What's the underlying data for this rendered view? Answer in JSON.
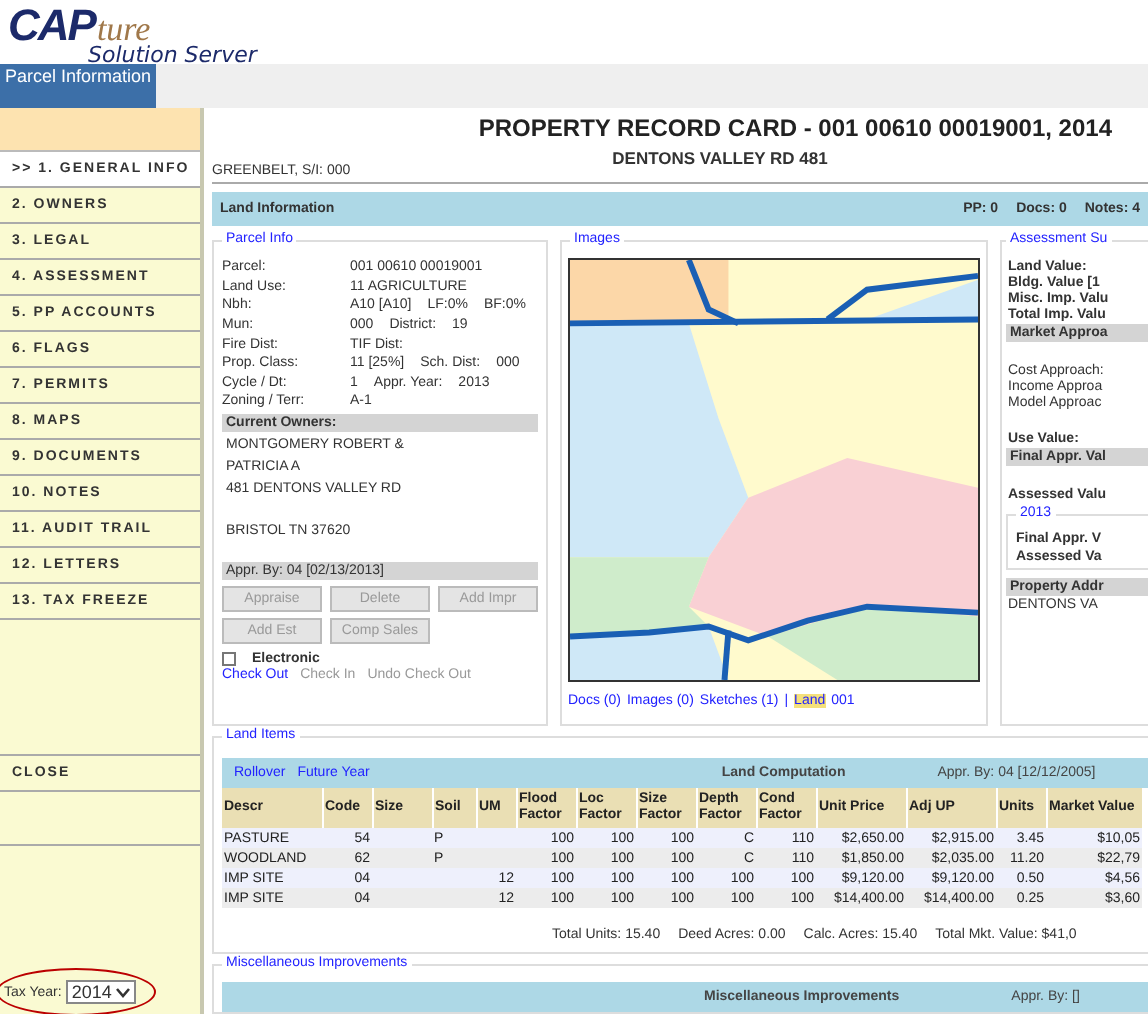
{
  "logo": {
    "main": "CAP",
    "script": "ture",
    "subtitle": "Solution Server"
  },
  "tabs": [
    {
      "label": "Parcel Information",
      "selected": true
    }
  ],
  "sidebar": {
    "items": [
      {
        "label": ">> 1. GENERAL INFO",
        "selected": true
      },
      {
        "label": "2. OWNERS",
        "selected": false
      },
      {
        "label": "3. LEGAL",
        "selected": false
      },
      {
        "label": "4. ASSESSMENT",
        "selected": false
      },
      {
        "label": "5. PP ACCOUNTS",
        "selected": false
      },
      {
        "label": "6. FLAGS",
        "selected": false
      },
      {
        "label": "7. PERMITS",
        "selected": false
      },
      {
        "label": "8. MAPS",
        "selected": false
      },
      {
        "label": "9. DOCUMENTS",
        "selected": false
      },
      {
        "label": "10. NOTES",
        "selected": false
      },
      {
        "label": "11. AUDIT TRAIL",
        "selected": false
      },
      {
        "label": "12. LETTERS",
        "selected": false
      },
      {
        "label": "13. TAX FREEZE",
        "selected": false
      }
    ],
    "close": "CLOSE",
    "tax_year": {
      "label": "Tax Year:",
      "value": "2014",
      "highlighted": true
    }
  },
  "header": {
    "title": "PROPERTY RECORD CARD - 001 00610 00019001, 2014",
    "address": "DENTONS VALLEY RD 481",
    "district": "GREENBELT, S/I: 000"
  },
  "land_information": {
    "title": "Land Information",
    "counts": [
      "PP: 0",
      "Docs: 0",
      "Notes: 4"
    ]
  },
  "parcel_info": {
    "legend": "Parcel Info",
    "rows": [
      [
        "Parcel:",
        "001 00610 00019001"
      ],
      [
        "Land Use:",
        "11 AGRICULTURE"
      ],
      [
        "Nbh:",
        "A10  [A10]",
        "LF:0%",
        "BF:0%"
      ],
      [
        "Mun:",
        "000",
        "District:",
        "19"
      ],
      [
        "Fire Dist:",
        "TIF Dist:"
      ],
      [
        "Prop. Class:",
        "11  [25%]",
        "Sch. Dist:",
        "000"
      ],
      [
        "Cycle / Dt:",
        "1",
        "Appr. Year:",
        "2013"
      ],
      [
        "Zoning / Terr:",
        "A-1"
      ]
    ],
    "owners_header": "Current Owners:",
    "owner_lines": [
      {
        "text": "MONTGOMERY ROBERT &",
        "gap_before": false
      },
      {
        "text": "PATRICIA A",
        "gap_before": false
      },
      {
        "text": "481 DENTONS VALLEY RD",
        "gap_before": false
      },
      {
        "text": "BRISTOL TN 37620",
        "gap_before": true
      }
    ],
    "appraised_by": "Appr. By: 04 [02/13/2013]",
    "buttons": [
      {
        "label": "Appraise",
        "disabled": true
      },
      {
        "label": "Delete",
        "disabled": true
      },
      {
        "label": "Add Impr",
        "disabled": true
      },
      {
        "label": "Add Est",
        "disabled": true
      },
      {
        "label": "Comp Sales",
        "disabled": true
      }
    ],
    "electronic": {
      "label": "Electronic",
      "checked": false
    },
    "links": [
      {
        "label": "Check Out",
        "disabled": false
      },
      {
        "label": "Check In",
        "disabled": true
      },
      {
        "label": "Undo Check Out",
        "disabled": true
      }
    ]
  },
  "images": {
    "legend": "Images",
    "links": [
      {
        "label": "Docs (0)",
        "highlighted": false
      },
      {
        "label": "Images (0)",
        "highlighted": false
      },
      {
        "label": "Sketches (1)",
        "highlighted": false
      },
      {
        "label": "|",
        "highlighted": false
      },
      {
        "label": "Land",
        "highlighted": true
      },
      {
        "label": "001",
        "highlighted": false
      }
    ]
  },
  "assessment_summary": {
    "legend": "Assessment Su",
    "rows": [
      {
        "kind": "bold",
        "text": "Land Value:",
        "gap_before": false
      },
      {
        "kind": "bold",
        "text": "Bldg. Value  [1",
        "gap_before": false
      },
      {
        "kind": "bold",
        "text": "Misc. Imp. Valu",
        "gap_before": false
      },
      {
        "kind": "bold",
        "text": "Total Imp. Valu",
        "gap_before": false
      },
      {
        "kind": "bar",
        "text": "Market Approa",
        "gap_before": false
      },
      {
        "kind": "plain",
        "text": "Cost Approach:",
        "gap_before": true
      },
      {
        "kind": "plain",
        "text": "Income Approa",
        "gap_before": false
      },
      {
        "kind": "plain",
        "text": "Model Approac",
        "gap_before": false
      },
      {
        "kind": "bold",
        "text": "Use Value:",
        "gap_before": true
      },
      {
        "kind": "bar",
        "text": "Final Appr. Val",
        "gap_before": false
      },
      {
        "kind": "bold",
        "text": "Assessed Valu",
        "gap_before": true
      }
    ],
    "year": {
      "legend": "2013",
      "rows": [
        "Final Appr. V",
        "Assessed Va"
      ]
    },
    "tail": [
      {
        "kind": "bar",
        "text": "Property Addr",
        "gap_before": false
      },
      {
        "kind": "plain",
        "text": "DENTONS VA",
        "gap_before": false
      }
    ]
  },
  "land_items": {
    "legend": "Land Items",
    "links": [
      "Rollover",
      "Future Year"
    ],
    "title": "Land Computation",
    "appraised_by": "Appr. By: 04 [12/12/2005]",
    "columns": [
      "Descr",
      "Code",
      "Size",
      "Soil",
      "UM",
      "Flood Factor",
      "Loc Factor",
      "Size Factor",
      "Depth Factor",
      "Cond Factor",
      "Unit Price",
      "Adj UP",
      "Units",
      "Market Value"
    ],
    "rows": [
      [
        "PASTURE",
        "54",
        "",
        "P",
        "",
        "100",
        "100",
        "100",
        "C",
        "110",
        "$2,650.00",
        "$2,915.00",
        "3.45",
        "$10,05"
      ],
      [
        "WOODLAND",
        "62",
        "",
        "P",
        "",
        "100",
        "100",
        "100",
        "C",
        "110",
        "$1,850.00",
        "$2,035.00",
        "11.20",
        "$22,79"
      ],
      [
        "IMP SITE",
        "04",
        "",
        "",
        "12",
        "100",
        "100",
        "100",
        "100",
        "100",
        "$9,120.00",
        "$9,120.00",
        "0.50",
        "$4,56"
      ],
      [
        "IMP SITE",
        "04",
        "",
        "",
        "12",
        "100",
        "100",
        "100",
        "100",
        "100",
        "$14,400.00",
        "$14,400.00",
        "0.25",
        "$3,60"
      ]
    ],
    "totals": [
      "Total Units: 15.40",
      "Deed Acres: 0.00",
      "Calc. Acres: 15.40",
      "Total Mkt. Value: $41,0"
    ]
  },
  "misc_improvements": {
    "legend": "Miscellaneous Improvements",
    "title": "Miscellaneous Improvements",
    "appraised_by": "Appr. By: []"
  }
}
